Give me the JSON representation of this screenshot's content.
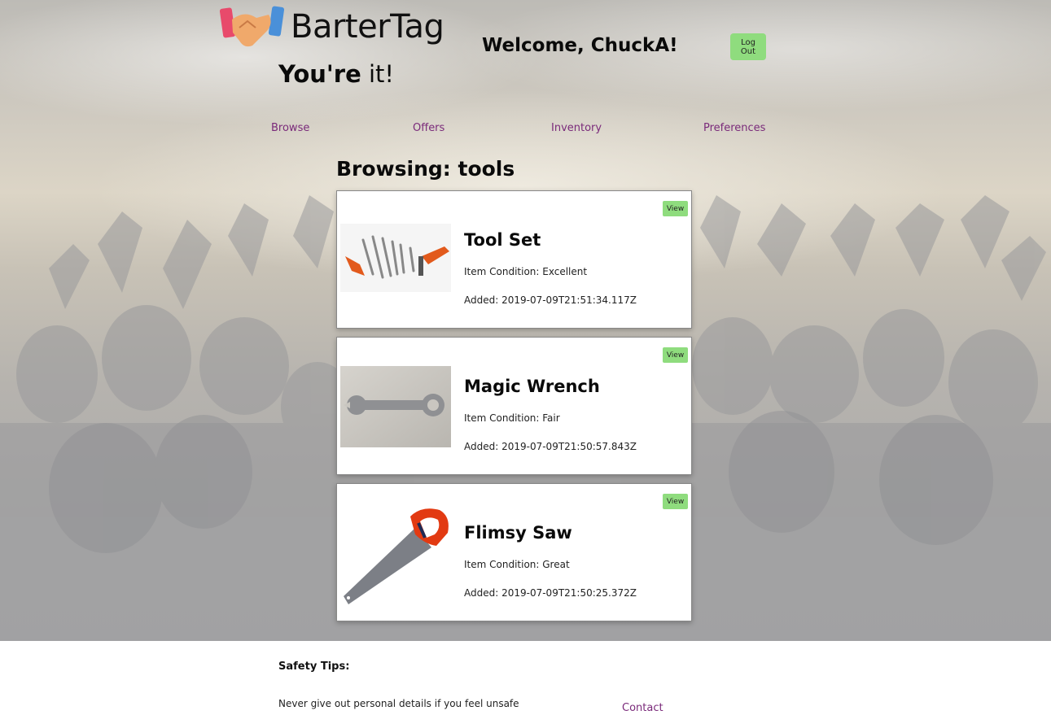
{
  "header": {
    "logo_text": "BarterTag",
    "tagline_bold": "You're",
    "tagline_light": " it!",
    "welcome": "Welcome, ChuckA!",
    "logout_label": "Log Out"
  },
  "nav": {
    "items": [
      {
        "label": "Browse"
      },
      {
        "label": "Offers"
      },
      {
        "label": "Inventory"
      },
      {
        "label": "Preferences"
      }
    ]
  },
  "main": {
    "heading": "Browsing: tools",
    "items": [
      {
        "title": "Tool Set",
        "condition": "Item Condition: Excellent",
        "added": "Added: 2019-07-09T21:51:34.117Z",
        "view_label": "View",
        "image": "tool-set"
      },
      {
        "title": "Magic Wrench",
        "condition": "Item Condition: Fair",
        "added": "Added: 2019-07-09T21:50:57.843Z",
        "view_label": "View",
        "image": "wrench"
      },
      {
        "title": "Flimsy Saw",
        "condition": "Item Condition: Great",
        "added": "Added: 2019-07-09T21:50:25.372Z",
        "view_label": "View",
        "image": "saw"
      }
    ]
  },
  "footer": {
    "safety_title": "Safety Tips:",
    "tips": [
      "Never give out personal details if you feel unsafe"
    ],
    "contact_label": "Contact"
  },
  "colors": {
    "accent_green": "#8fdc7e",
    "link_purple": "#7a2a7a"
  }
}
